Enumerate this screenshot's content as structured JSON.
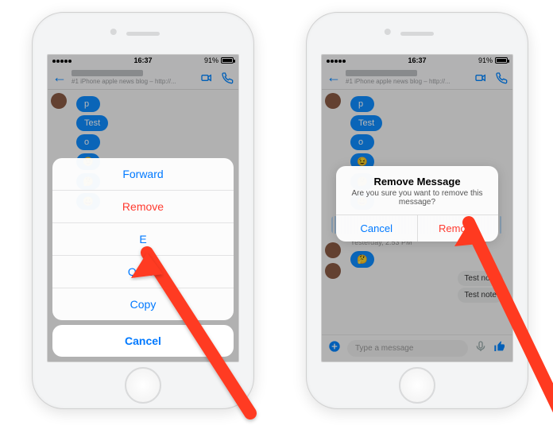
{
  "status": {
    "time": "16:37",
    "battery": "91%"
  },
  "header": {
    "subtitle": "#1 iPhone apple news blog – http://..."
  },
  "messages": {
    "m_p": "p",
    "m_test": "Test",
    "m_o": "o",
    "emoji1": "😉",
    "emoji2": "🤔",
    "emoji3": "😀",
    "emoji4": "🤔",
    "note1": "Test note",
    "note2": "Test note",
    "timelabel": "Yesterday, 2:53 PM"
  },
  "composer": {
    "placeholder": "Type a message"
  },
  "action_sheet": {
    "forward": "Forward",
    "remove": "Remove",
    "edit": "E",
    "quote": "Quote",
    "copy": "Copy",
    "cancel": "Cancel"
  },
  "alert": {
    "title": "Remove Message",
    "body": "Are you sure you want to remove this message?",
    "cancel": "Cancel",
    "remove": "Remove"
  }
}
